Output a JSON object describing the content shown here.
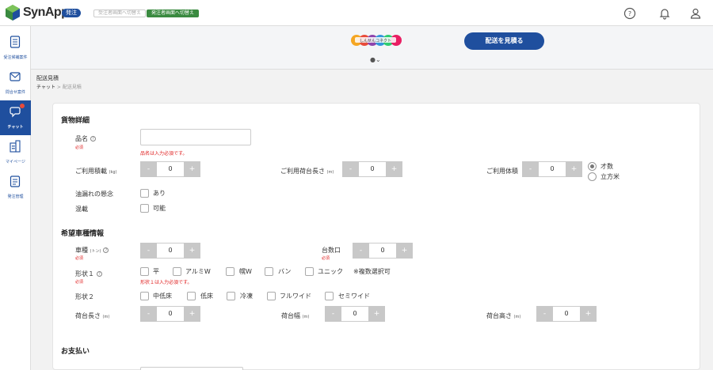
{
  "header": {
    "brand": "SynApp",
    "role_badge": "発注",
    "switch_orderer_label": "受注者画面へ切替え",
    "switch_shipper_label": "発注者画面へ切替え",
    "help_icon": "help-circle-icon",
    "bell_icon": "bell-icon",
    "user_icon": "user-icon"
  },
  "sidebar": {
    "items": [
      {
        "label": "受注候補案件",
        "icon": "document-list-icon"
      },
      {
        "label": "問合せ案件",
        "icon": "mail-icon"
      },
      {
        "label": "チャット",
        "icon": "chat-icon",
        "active": true
      },
      {
        "label": "マイページ",
        "icon": "building-icon"
      },
      {
        "label": "発注管理",
        "icon": "clipboard-icon"
      }
    ]
  },
  "subheader": {
    "partner_logo_text": "しんせんコネクト",
    "estimate_button": "配送を見積る",
    "user_toggle": "●⌄"
  },
  "breadcrumb": {
    "title": "配送見積",
    "path_root": "チャット",
    "separator": ">",
    "path_current": "配送見積"
  },
  "cargo": {
    "section_title": "貨物詳細",
    "item_name_label": "品名",
    "required": "必須",
    "item_name_value": "",
    "item_name_error": "品名は入力必須です。",
    "volume_label": "ご利用積載",
    "volume_unit": "(kg)",
    "volume_value": "0",
    "bed_length_label": "ご利用荷台長さ",
    "bed_length_unit": "(m)",
    "bed_length_value": "0",
    "capacity_label": "ご利用体積",
    "capacity_value": "0",
    "capacity_unit_options": [
      "才数",
      "立方米"
    ],
    "capacity_unit_selected": "才数",
    "oil_leak_label": "油漏れの懸念",
    "oil_leak_option": "あり",
    "mixed_label": "混載",
    "mixed_option": "可能"
  },
  "vehicle": {
    "section_title": "希望車種情報",
    "type_label": "車種",
    "type_unit": "(トン)",
    "type_value": "0",
    "count_label": "台数口",
    "count_value": "0",
    "required": "必須",
    "shape1_label": "形状１",
    "shape1_options": [
      "平",
      "アルミW",
      "幌W",
      "バン",
      "ユニック"
    ],
    "shape1_note": "※複数選択可",
    "shape1_error": "形状１は入力必須です。",
    "shape2_label": "形状２",
    "shape2_options": [
      "中低床",
      "低床",
      "冷凍",
      "フルワイド",
      "セミワイド"
    ],
    "bed_length_label": "荷台長さ",
    "bed_width_label": "荷台幅",
    "bed_height_label": "荷台高さ",
    "dim_unit": "(m)",
    "bed_length_value": "0",
    "bed_width_value": "0",
    "bed_height_value": "0"
  },
  "payment": {
    "section_title": "お支払い"
  },
  "stepper": {
    "minus": "-",
    "plus": "+"
  }
}
